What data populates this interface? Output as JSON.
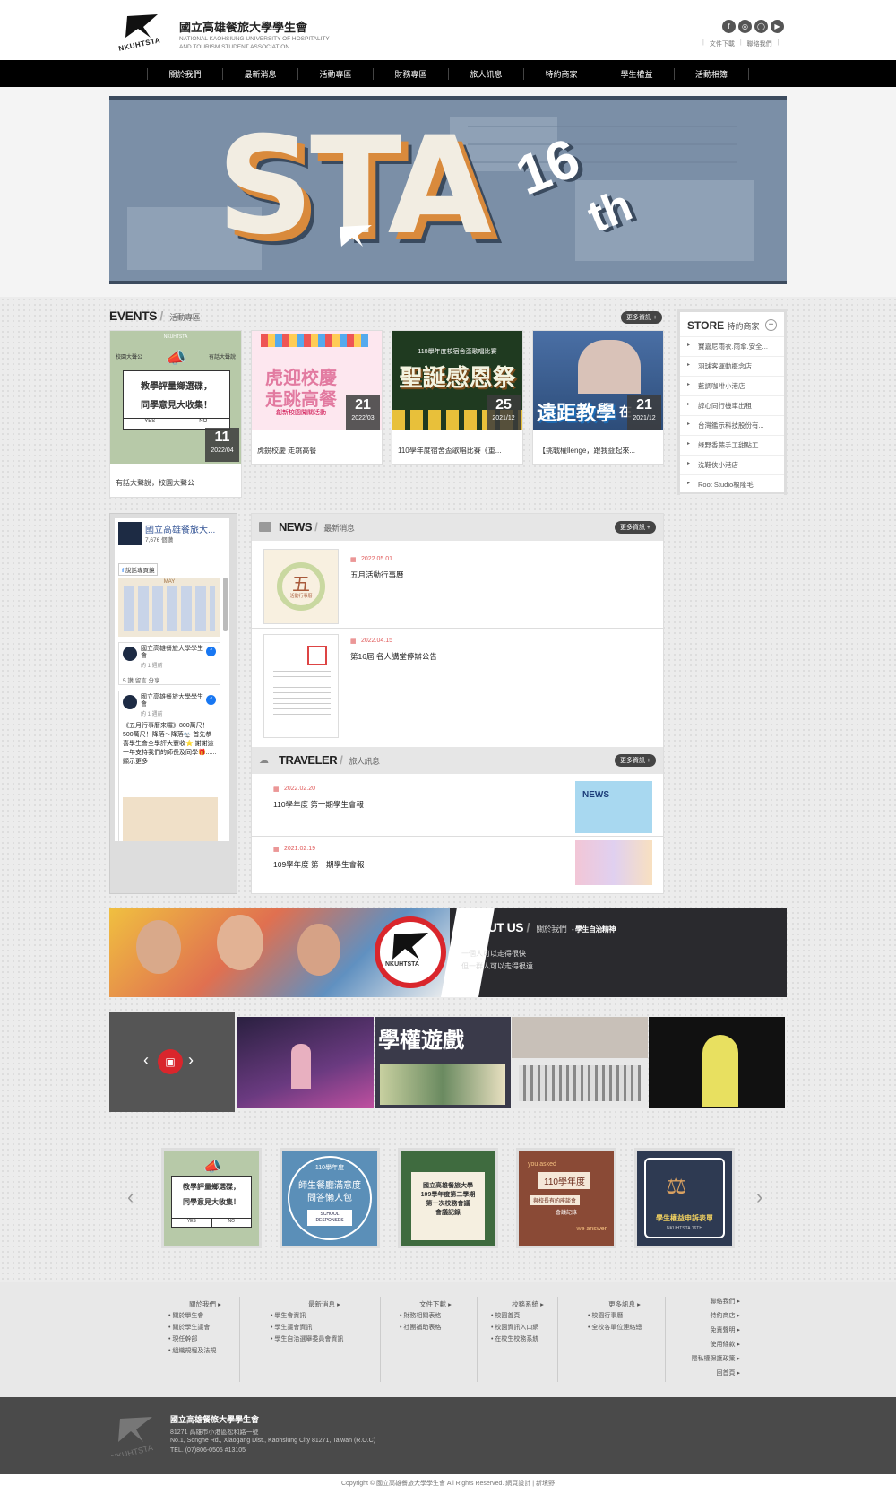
{
  "header": {
    "title": "國立高雄餐旅大學學生會",
    "subtitle_en_1": "NATIONAL KAOHSIUNG UNIVERSITY OF HOSPITALITY",
    "subtitle_en_2": "AND TOURISM STUDENT ASSOCIATION",
    "logo_text": "NKUHTSTA",
    "social": [
      "facebook-icon",
      "instagram-icon",
      "line-icon",
      "youtube-icon"
    ],
    "links": [
      "文件下載",
      "聯絡我們"
    ]
  },
  "nav": [
    "關於我們",
    "最新消息",
    "活動專區",
    "財務專區",
    "旅人訊息",
    "特約商家",
    "學生權益",
    "活動相簿"
  ],
  "banner": {
    "big": "STA",
    "num": "16",
    "sup": "th"
  },
  "events": {
    "title": "EVENTS",
    "subtitle": "活動專區",
    "more": "更多資訊 +",
    "items": [
      {
        "caption": "有話大聲說，校園大聲公",
        "day": "11",
        "ym": "2022/04",
        "img_text_1": "教學評量鄉選碟，",
        "img_text_2": "同學意見大收集！",
        "yes": "YES",
        "no": "NO",
        "img_top": "NKUHTSTA",
        "img_left": "校園大聲公",
        "img_right": "有話大聲說"
      },
      {
        "caption": "虎鋭校慶 走跳高餐",
        "day": "21",
        "ym": "2022/03",
        "img_text_1": "虎迎校慶",
        "img_text_2": "走跳高餐",
        "img_sub": "創新校園闖關活動"
      },
      {
        "caption": "110學年度宿舍盃歌唱比賽《重...",
        "day": "25",
        "ym": "2021/12",
        "img_text_1": "聖誕感恩祭",
        "img_top": "110學年度校宿舍盃歌唱比賽"
      },
      {
        "caption": "【挑戰權llenge，跟我益起來...",
        "day": "21",
        "ym": "2021/12",
        "img_text_1": "遠距教學",
        "img_tag": "在"
      }
    ]
  },
  "store": {
    "title": "STORE",
    "subtitle": "特約商家",
    "items": [
      "寶嘉尼雨衣.雨傘.安全...",
      "羽球客運動概念店",
      "藍調咖啡小港店",
      "諄心同行機車出租",
      "台灣鑑示科技股份有...",
      "綠野香蕨手工甜點工...",
      "洗鞋俠小港店",
      "Root Studio根隆毛"
    ]
  },
  "facebook": {
    "page_name": "國立高雄餐旅大...",
    "followers": "7,676 個讚",
    "badge": "說話專頁鏡",
    "post1_name": "國立高雄餐旅大學學生會",
    "post1_time": "約 1 週前",
    "post1_actions": "5  讚 留言 分享",
    "post2_name": "國立高雄餐旅大學學生會",
    "post2_time": "約 1 週前",
    "post2_text": "《五月行事曆來囉》800萬尺！500萬尺！降落～降落🛬 首先恭喜學生會全學評大豐收⭐ 謝謝這一年支持我們的師長及同學🎁...... 顯示更多",
    "calendar_label": "MAY"
  },
  "news": {
    "title": "NEWS",
    "subtitle": "最新消息",
    "more": "更多資訊 +",
    "items": [
      {
        "date": "2022.05.01",
        "title": "五月活動行事曆",
        "thumb_char": "五",
        "thumb_sub": "活動行事曆"
      },
      {
        "date": "2022.04.15",
        "title": "第16屆 名人講堂停辦公告"
      }
    ]
  },
  "traveler": {
    "title": "TRAVELER",
    "subtitle": "旅人訊息",
    "more": "更多資訊 +",
    "items": [
      {
        "date": "2022.02.20",
        "title": "110學年度 第一期學生會報",
        "thumb_tag": "NEWS"
      },
      {
        "date": "2021.02.19",
        "title": "109學年度 第一期學生會報"
      }
    ]
  },
  "about": {
    "title": "ABOUT US",
    "subtitle": "關於我們",
    "tag": "學生自治精神",
    "line1": "一個人可以走得很快",
    "line2": "但一群人可以走得很遠",
    "logo_text": "NKUHTSTA"
  },
  "gallery": {
    "tile_text": "學權遊戲"
  },
  "carousel": [
    {
      "t1": "教學評量鄉選碟，",
      "t2": "同學意見大收集！",
      "yes": "YES",
      "no": "NO"
    },
    {
      "t0": "110學年度",
      "t1": "師生餐廳滿意度",
      "t2": "問答懶人包",
      "t3": "SCHOOL DESPONSES"
    },
    {
      "t1": "國立高雄餐旅大學",
      "t2": "109學年度第二學期",
      "t3": "第一次校務會議",
      "t4": "會議記錄"
    },
    {
      "t0": "you asked",
      "t1": "110學年度",
      "t2": "與校長有約座談會",
      "t3": "會議記錄",
      "t4": "we answer"
    },
    {
      "t1": "學生權益申訴表單",
      "t2": "NKUHTSTA 16TH"
    }
  ],
  "footer": {
    "cols": [
      {
        "head": "關於我們 ▸",
        "items": [
          "• 關於學生會",
          "• 關於學生議會",
          "• 現任幹部",
          "• 組織規程及法規"
        ]
      },
      {
        "head": "最新消息 ▸",
        "items": [
          "• 學生會資訊",
          "• 學生議會資訊",
          "• 學生自治選舉委員會資訊"
        ]
      },
      {
        "head": "文件下載 ▸",
        "items": [
          "• 財務相關表格",
          "• 社團補助表格"
        ]
      },
      {
        "head": "校務系統 ▸",
        "items": [
          "• 校園首頁",
          "• 校園資訊入口網",
          "• 在校生校務系統"
        ]
      },
      {
        "head": "更多訊息 ▸",
        "items": [
          "• 校園行事曆",
          "• 全校各單位連絡總"
        ]
      }
    ],
    "right": [
      "聯絡我們 ▸",
      "特約商店 ▸",
      "免責聲明 ▸",
      "使用條款 ▸",
      "隱私權保護政策 ▸",
      "回首頁 ▸"
    ],
    "org": "國立高雄餐旅大學學生會",
    "addr1": "81271 高雄市小港區松和路一號",
    "addr2": "No.1, Songhe Rd., Xiaogang Dist., Kaohsiung City 81271, Taiwan (R.O.C)",
    "tel": "TEL. (07)806-0505 #13105",
    "copyright": "Copyright © 國立高雄餐旅大學學生會 All Rights Reserved. 網頁設計 | 新境野"
  }
}
